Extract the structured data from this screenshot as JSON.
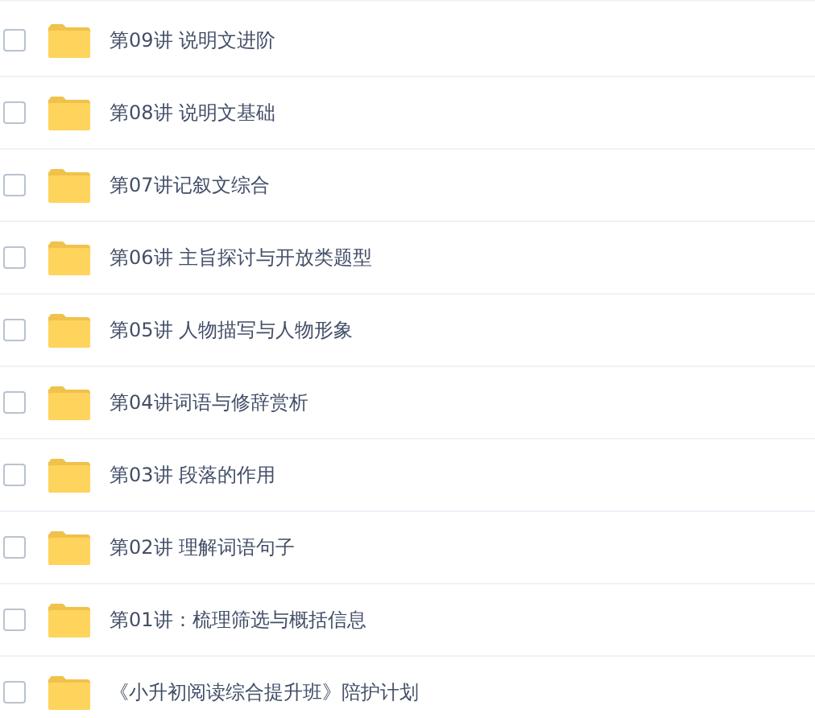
{
  "files": [
    {
      "name": "第09讲 说明文进阶",
      "checked": false
    },
    {
      "name": "第08讲 说明文基础",
      "checked": false
    },
    {
      "name": "第07讲记叙文综合",
      "checked": false
    },
    {
      "name": "第06讲 主旨探讨与开放类题型",
      "checked": false
    },
    {
      "name": "第05讲 人物描写与人物形象",
      "checked": false
    },
    {
      "name": "第04讲词语与修辞赏析",
      "checked": false
    },
    {
      "name": "第03讲 段落的作用",
      "checked": false
    },
    {
      "name": "第02讲 理解词语句子",
      "checked": false
    },
    {
      "name": "第01讲：梳理筛选与概括信息",
      "checked": false
    },
    {
      "name": "《小升初阅读综合提升班》陪护计划",
      "checked": false
    }
  ]
}
